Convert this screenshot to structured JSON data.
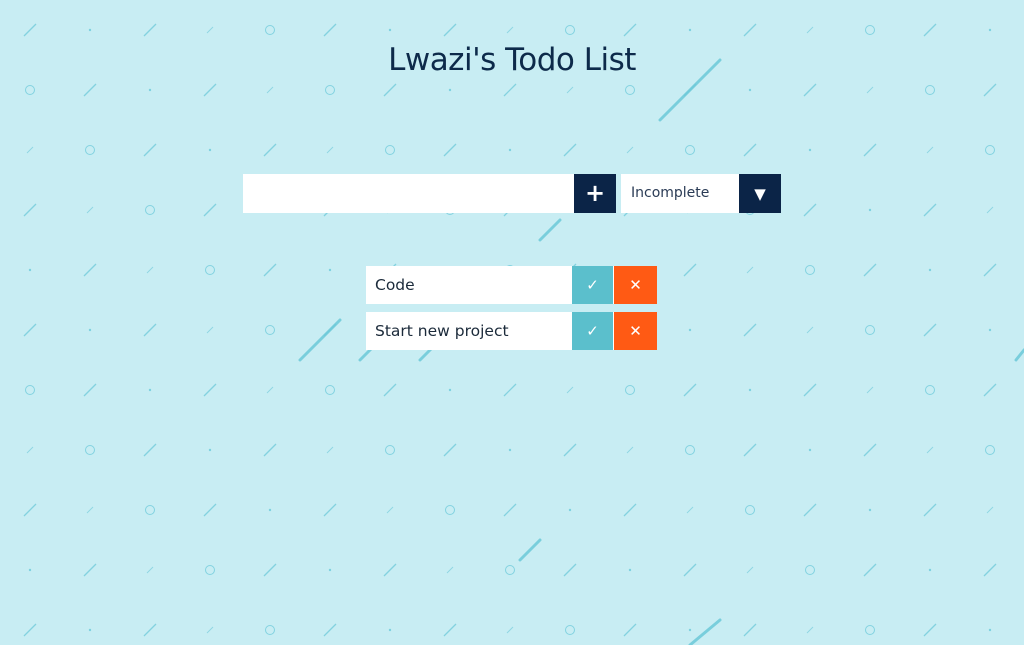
{
  "app": {
    "title": "Lwazi's Todo List"
  },
  "form": {
    "input_value": "",
    "input_placeholder": "",
    "add_icon": "plus-icon",
    "add_glyph": "+",
    "filter_selected": "Incomplete",
    "filter_arrow_glyph": "▼"
  },
  "todos": [
    {
      "text": "Code",
      "complete_glyph": "✓",
      "delete_glyph": "✕"
    },
    {
      "text": "Start new project",
      "complete_glyph": "✓",
      "delete_glyph": "✕"
    }
  ],
  "colors": {
    "background": "#c8edf3",
    "pattern": "#6cc9d9",
    "accent_dark": "#0b2447",
    "complete": "#5bbfcc",
    "delete": "#ff5a14"
  }
}
